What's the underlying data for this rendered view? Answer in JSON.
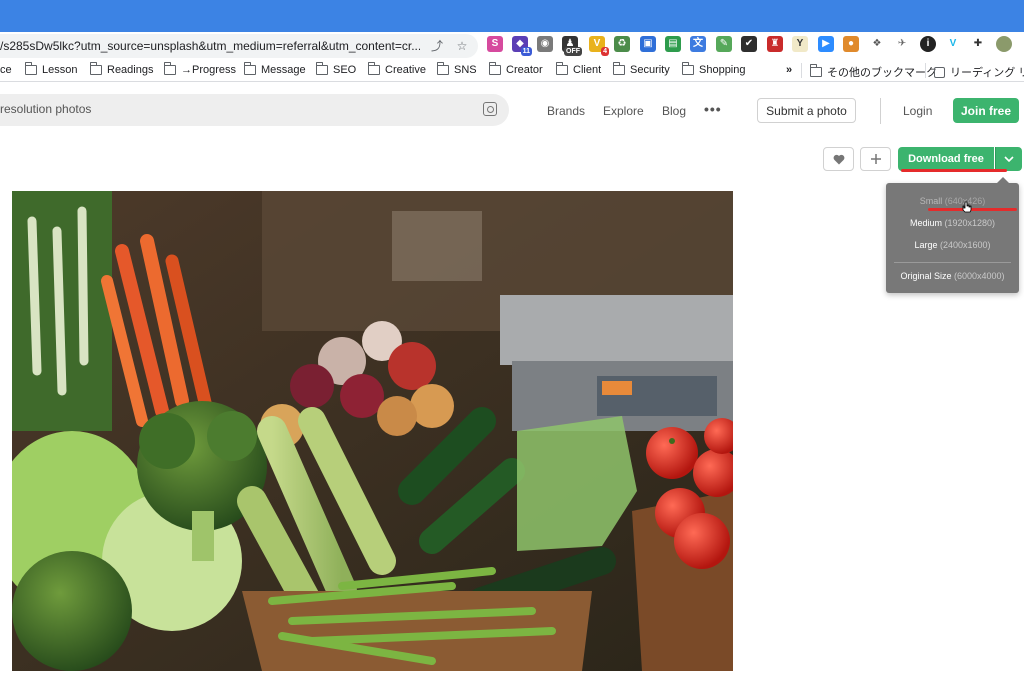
{
  "browser": {
    "url": "/s285sDw5lkc?utm_source=unsplash&utm_medium=referral&utm_content=cr...",
    "extension_badges": {
      "ext5": "11",
      "ext6": "OFF",
      "ext7": "4"
    },
    "bookmarks": [
      "ce",
      "Lesson",
      "Readings",
      "→Progress",
      "Message",
      "SEO",
      "Creative",
      "SNS",
      "Creator",
      "Client",
      "Security",
      "Shopping"
    ],
    "more_bookmarks": "»",
    "other_bookmarks": "その他のブックマーク",
    "reading_list": "リーディング リス"
  },
  "header": {
    "search_placeholder": "resolution photos",
    "nav": [
      "Brands",
      "Explore",
      "Blog"
    ],
    "more": "•••",
    "submit": "Submit a photo",
    "login": "Login",
    "join": "Join free"
  },
  "actions": {
    "download": "Download free"
  },
  "download_menu": {
    "items": [
      {
        "label": "Small",
        "size": "(640x426)"
      },
      {
        "label": "Medium",
        "size": "(1920x1280)"
      },
      {
        "label": "Large",
        "size": "(2400x1600)"
      }
    ],
    "original": {
      "label": "Original Size",
      "size": "(6000x4000)"
    }
  },
  "colors": {
    "brand_green": "#3cb46e",
    "chrome_blue": "#3c83e4",
    "annotation_red": "#e52b2b"
  }
}
